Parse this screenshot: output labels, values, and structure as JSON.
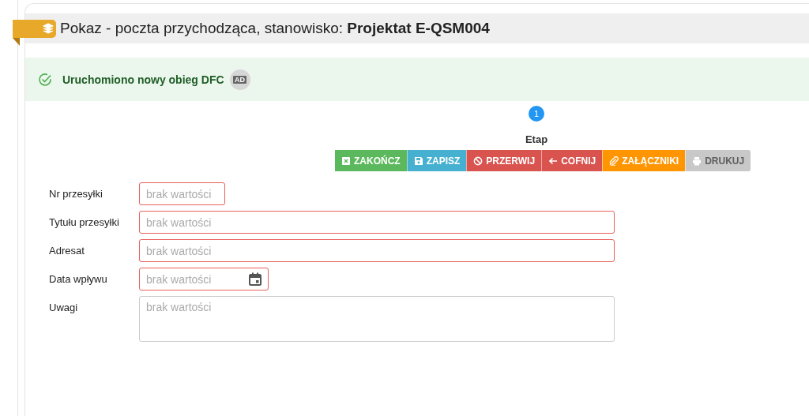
{
  "header": {
    "title": "Pokaz - poczta przychodząca, stanowisko: **Projektat E-QSM004**"
  },
  "alert": {
    "message": "Uruchomiono nowy obieg DFC",
    "badge": "AD"
  },
  "step": {
    "number": "1",
    "label": "Etap"
  },
  "buttons": [
    {
      "label": "ZAKOŃCZ",
      "color": "#5cb85c",
      "disabled": false
    },
    {
      "label": "ZAPISZ",
      "color": "#46b0d0",
      "disabled": false
    },
    {
      "label": "PRZERWIJ",
      "color": "#d9534f",
      "disabled": false
    },
    {
      "label": "COFNIJ",
      "color": "#d9534f",
      "disabled": false
    },
    {
      "label": "ZAŁĄCZNIKI",
      "color": "#ff9500",
      "disabled": false
    },
    {
      "label": "DRUKUJ",
      "color": "#c8c8c8",
      "disabled": true
    }
  ],
  "fields": [
    {
      "label": "Nr przesyłki",
      "kind": "short",
      "placeholder": "brak wartości",
      "invalid": true
    },
    {
      "label": "Tytułu przesyłki",
      "kind": "text",
      "placeholder": "brak wartości",
      "invalid": true
    },
    {
      "label": "Adresat",
      "kind": "text",
      "placeholder": "brak wartości",
      "invalid": true
    },
    {
      "label": "Data wpływu",
      "kind": "date",
      "placeholder": "brak wartości",
      "invalid": true
    },
    {
      "label": "Uwagi",
      "kind": "textarea",
      "placeholder": "brak wartości",
      "invalid": false
    }
  ]
}
